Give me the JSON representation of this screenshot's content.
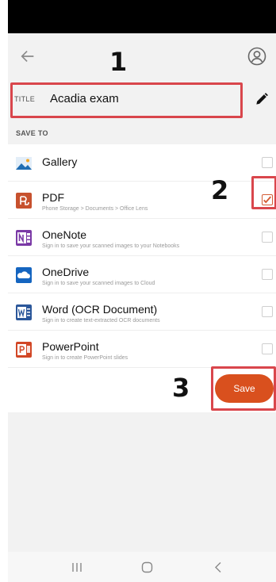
{
  "header": {
    "back_icon": "arrow-left-icon",
    "account_icon": "account-circle-icon"
  },
  "title_field": {
    "label": "TITLE",
    "value": "Acadia exam",
    "edit_icon": "pencil-icon"
  },
  "save_to": {
    "label": "SAVE TO",
    "items": [
      {
        "name": "Gallery",
        "subtitle": "",
        "icon": "gallery-icon",
        "checked": false
      },
      {
        "name": "PDF",
        "subtitle": "Phone Storage > Documents > Office Lens",
        "icon": "pdf-icon",
        "checked": true
      },
      {
        "name": "OneNote",
        "subtitle": "Sign in to save your scanned images to your Notebooks",
        "icon": "onenote-icon",
        "checked": false
      },
      {
        "name": "OneDrive",
        "subtitle": "Sign in to save your scanned images to Cloud",
        "icon": "onedrive-icon",
        "checked": false
      },
      {
        "name": "Word (OCR Document)",
        "subtitle": "Sign in to create text-extracted OCR documents",
        "icon": "word-icon",
        "checked": false
      },
      {
        "name": "PowerPoint",
        "subtitle": "Sign in to create PowerPoint slides",
        "icon": "powerpoint-icon",
        "checked": false
      }
    ]
  },
  "save_button": {
    "label": "Save"
  },
  "annotations": {
    "step1": "1",
    "step2": "2",
    "step3": "3"
  },
  "colors": {
    "accent": "#d9501e",
    "annotation": "#d9464c",
    "pdf": "#c7512e",
    "onenote": "#7b3aa6",
    "onedrive": "#1565c0",
    "word": "#2b579a",
    "powerpoint": "#d24726"
  },
  "navbar": {
    "recents_icon": "recents-icon",
    "home_icon": "home-icon",
    "back_icon": "nav-back-icon"
  }
}
